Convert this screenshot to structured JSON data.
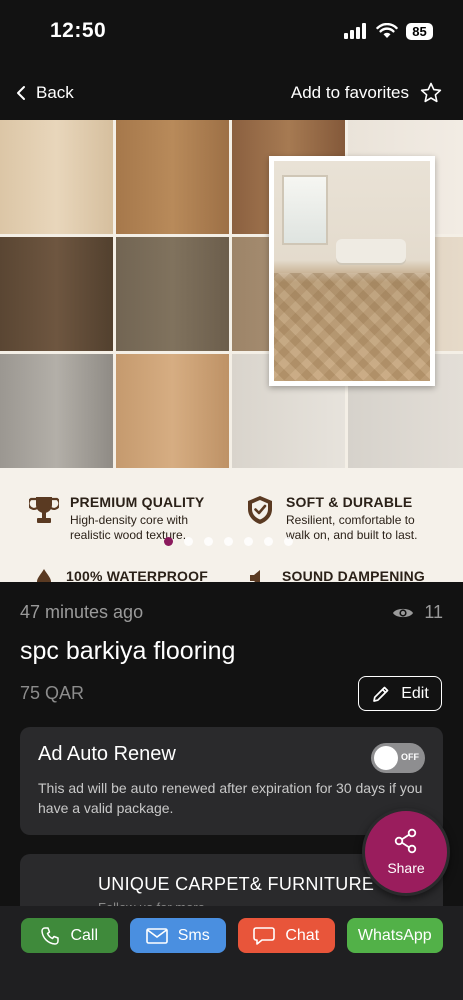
{
  "status_bar": {
    "time": "12:50",
    "battery": "85"
  },
  "nav": {
    "back_label": "Back",
    "favorites_label": "Add to favorites"
  },
  "hero": {
    "features": [
      {
        "title": "PREMIUM QUALITY",
        "desc": "High-density core with realistic wood texture.",
        "icon": "trophy-icon"
      },
      {
        "title": "SOFT & DURABLE",
        "desc": "Resilient, comfortable to walk on, and built to last.",
        "icon": "shield-check-icon"
      },
      {
        "title": "100% WATERPROOF",
        "desc": "",
        "icon": "drop-icon"
      },
      {
        "title": "SOUND DAMPENING",
        "desc": "",
        "icon": "speaker-icon"
      }
    ],
    "image_count": 7,
    "active_image": 0,
    "accent_color": "#8b1a5d"
  },
  "listing": {
    "posted": "47 minutes ago",
    "views": "11",
    "title": "spc barkiya flooring",
    "price": "75 QAR",
    "edit_label": "Edit"
  },
  "auto_renew": {
    "title": "Ad Auto Renew",
    "description": "This ad will be auto renewed after expiration for 30 days if you have a valid package.",
    "toggle_state": "OFF"
  },
  "store": {
    "name": "UNIQUE CARPET& FURNITURE",
    "subtitle": "Follow us for more"
  },
  "share": {
    "label": "Share",
    "color": "#9a1d5d"
  },
  "actions": {
    "call": "Call",
    "sms": "Sms",
    "chat": "Chat",
    "whatsapp": "WhatsApp"
  }
}
